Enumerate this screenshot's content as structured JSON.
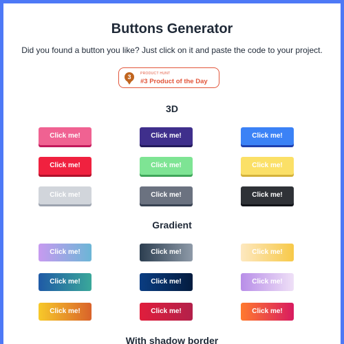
{
  "header": {
    "title": "Buttons Generator",
    "subtitle": "Did you found a button you like? Just click on it and paste the code to your project."
  },
  "badge": {
    "icon": "medal-icon",
    "medal_number": "3",
    "small_label": "PRODUCT HUNT",
    "main_label": "#3 Product of the Day",
    "color": "#e2553a"
  },
  "sections": [
    {
      "title": "3D",
      "buttons": [
        {
          "label": "Click me!",
          "color": "#f06292",
          "shadow": "#c2185b"
        },
        {
          "label": "Click me!",
          "color": "#3f2f8c",
          "shadow": "#231a5c"
        },
        {
          "label": "Click me!",
          "color": "#3b82f6",
          "shadow": "#1e40af"
        },
        {
          "label": "Click me!",
          "color": "#f0213f",
          "shadow": "#b0102a"
        },
        {
          "label": "Click me!",
          "color": "#7ee494",
          "shadow": "#3fa65a"
        },
        {
          "label": "Click me!",
          "color": "#fbe067",
          "shadow": "#d4b23a"
        },
        {
          "label": "Click me!",
          "color": "#d1d5db",
          "shadow": "#9ca3af"
        },
        {
          "label": "Click me!",
          "color": "#6b7280",
          "shadow": "#374151"
        },
        {
          "label": "Click me!",
          "color": "#2f3237",
          "shadow": "#111318"
        }
      ]
    },
    {
      "title": "Gradient",
      "buttons": [
        {
          "label": "Click me!",
          "from": "#c79af0",
          "to": "#6bb6d6"
        },
        {
          "label": "Click me!",
          "from": "#2c3e50",
          "to": "#8e9aa8"
        },
        {
          "label": "Click me!",
          "from": "#fde8c0",
          "to": "#f7c948"
        },
        {
          "label": "Click me!",
          "from": "#1f5aa6",
          "to": "#3aa89a"
        },
        {
          "label": "Click me!",
          "from": "#0a3d82",
          "to": "#041c3f"
        },
        {
          "label": "Click me!",
          "from": "#b88ee8",
          "to": "#efe0f7"
        },
        {
          "label": "Click me!",
          "from": "#f7c92a",
          "to": "#d9622a"
        },
        {
          "label": "Click me!",
          "from": "#e01e3c",
          "to": "#b3204a"
        },
        {
          "label": "Click me!",
          "from": "#ff7a2f",
          "to": "#d81b60"
        }
      ]
    },
    {
      "title": "With shadow border",
      "buttons": []
    }
  ]
}
